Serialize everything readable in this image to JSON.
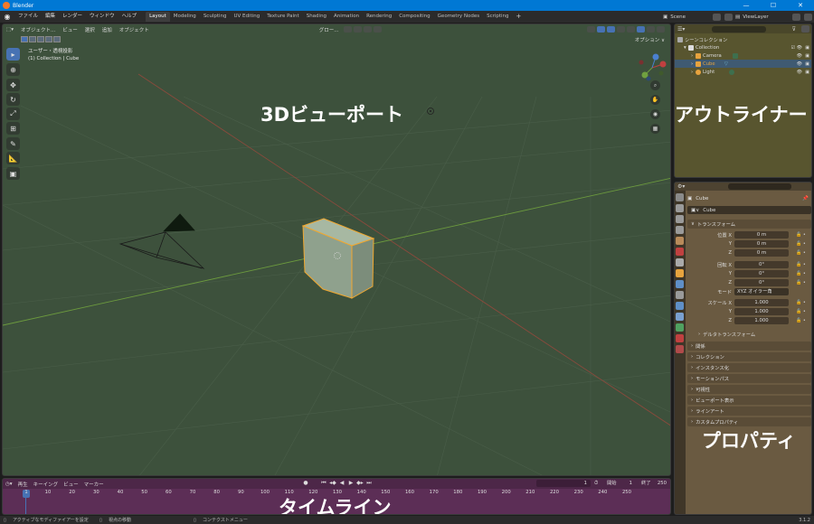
{
  "titlebar": {
    "title": "Blender",
    "min": "—",
    "max": "☐",
    "close": "✕"
  },
  "menu": [
    "ファイル",
    "編集",
    "レンダー",
    "ウィンドウ",
    "ヘルプ"
  ],
  "workspaces": [
    "Layout",
    "Modeling",
    "Sculpting",
    "UV Editing",
    "Texture Paint",
    "Shading",
    "Animation",
    "Rendering",
    "Compositing",
    "Geometry Nodes",
    "Scripting"
  ],
  "add_tab": "+",
  "scene_label": "Scene",
  "viewlayer_label": "ViewLayer",
  "viewport": {
    "mode": "オブジェクト...",
    "menus": [
      "ビュー",
      "選択",
      "追加",
      "オブジェクト"
    ],
    "transform_orient": "グロー...",
    "options": "オプション ∨",
    "view_name": "ユーザー・透視投影",
    "collection_info": "(1) Collection | Cube",
    "label": "3Dビューポート"
  },
  "outliner": {
    "label": "アウトライナー",
    "rows": [
      {
        "name": "シーンコレクション",
        "indent": 0,
        "color": "#cccccc"
      },
      {
        "name": "Collection",
        "indent": 1,
        "color": "#dddddd"
      },
      {
        "name": "Camera",
        "indent": 2,
        "color": "#e7a33e"
      },
      {
        "name": "Cube",
        "indent": 2,
        "color": "#e7a33e",
        "selected": true
      },
      {
        "name": "Light",
        "indent": 2,
        "color": "#e7a33e"
      }
    ]
  },
  "properties": {
    "label": "プロパティ",
    "object_name": "Cube",
    "object_field": "Cube",
    "transform_section": "トランスフォーム",
    "location_label": "位置 X",
    "rotation_label": "回転 X",
    "scale_label": "スケール X",
    "axis_y": "Y",
    "axis_z": "Z",
    "location": [
      "0 m",
      "0 m",
      "0 m"
    ],
    "rotation": [
      "0°",
      "0°",
      "0°"
    ],
    "mode_label": "モード",
    "mode_value": "XYZ オイラー角",
    "scale": [
      "1.000",
      "1.000",
      "1.000"
    ],
    "delta": "デルタトランスフォーム",
    "sections": [
      "関係",
      "コレクション",
      "インスタンス化",
      "モーションパス",
      "可視性",
      "ビューポート表示",
      "ラインアート",
      "カスタムプロパティ"
    ]
  },
  "timeline": {
    "label": "タイムライン",
    "menus": [
      "再生",
      "キーイング",
      "ビュー",
      "マーカー"
    ],
    "current_frame": "1",
    "start_label": "開始",
    "start": "1",
    "end_label": "終了",
    "end": "250",
    "ticks": [
      "1",
      "10",
      "20",
      "30",
      "40",
      "50",
      "60",
      "70",
      "80",
      "90",
      "100",
      "110",
      "120",
      "130",
      "140",
      "150",
      "160",
      "170",
      "180",
      "190",
      "200",
      "210",
      "220",
      "230",
      "240",
      "250"
    ]
  },
  "statusbar": {
    "left": "アクティブなモディファイアーを設定",
    "mid": "視点の移動",
    "right": "コンテクストメニュー",
    "version": "3.1.2"
  }
}
